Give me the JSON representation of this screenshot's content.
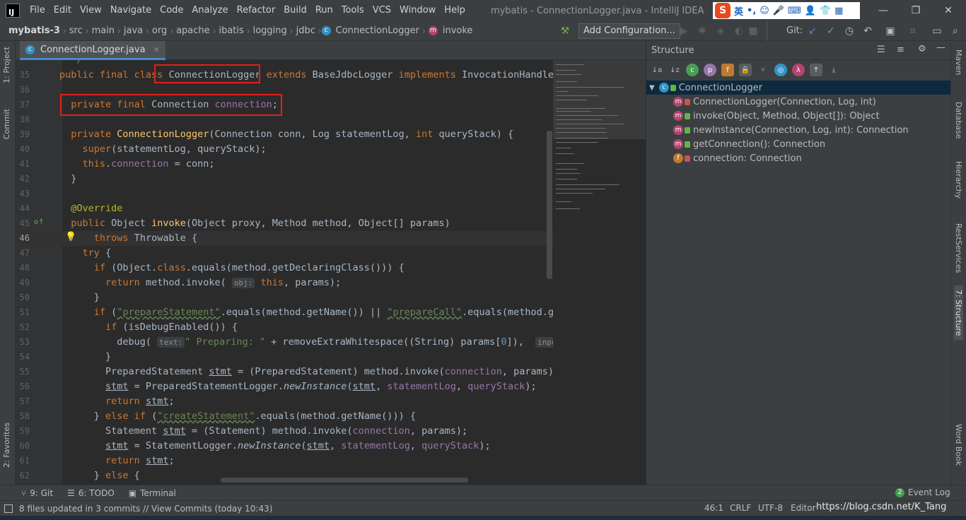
{
  "menubar": {
    "logo": "IJ",
    "items": [
      "File",
      "Edit",
      "View",
      "Navigate",
      "Code",
      "Analyze",
      "Refactor",
      "Build",
      "Run",
      "Tools",
      "VCS",
      "Window",
      "Help"
    ],
    "window_title": "mybatis - ConnectionLogger.java - IntelliJ IDEA",
    "ime": {
      "logo": "S",
      "lang": "英"
    }
  },
  "navbar": {
    "breadcrumbs": [
      "mybatis-3",
      "src",
      "main",
      "java",
      "org",
      "apache",
      "ibatis",
      "logging",
      "jdbc",
      "ConnectionLogger",
      "invoke"
    ],
    "run_config": "Add Configuration...",
    "git_label": "Git:"
  },
  "editor": {
    "tab_label": "ConnectionLogger.java",
    "cursor_line": "46",
    "hints": {
      "obj": "obj:",
      "text": "text:",
      "input": "input:"
    }
  },
  "structure": {
    "title": "Structure",
    "root": "ConnectionLogger",
    "items": [
      "ConnectionLogger(Connection, Log, int)",
      "invoke(Object, Method, Object[]): Object",
      "newInstance(Connection, Log, int): Connection",
      "getConnection(): Connection",
      "connection: Connection"
    ]
  },
  "left_tabs": [
    "1: Project",
    "Commit",
    "2: Favorites"
  ],
  "right_tabs": [
    "Maven",
    "Database",
    "Hierarchy",
    "RestServices",
    "7: Structure",
    "Word Book"
  ],
  "bottom_tools": {
    "git": "9: Git",
    "todo": "6: TODO",
    "terminal": "Terminal",
    "event_log": "Event Log",
    "event_count": "2"
  },
  "status": {
    "message": "8 files updated in 3 commits // View Commits (today 10:43)",
    "position": "46:1",
    "line_sep": "CRLF",
    "encoding": "UTF-8",
    "watermark": "https://blog.csdn.net/K_Tang",
    "editor_config": "Editor"
  },
  "colors": {
    "keyword": "#cc7832",
    "method": "#ffc66d",
    "field": "#9876aa",
    "string": "#6a8759",
    "annotation": "#bbb529",
    "highlight_box": "#e0201a"
  }
}
